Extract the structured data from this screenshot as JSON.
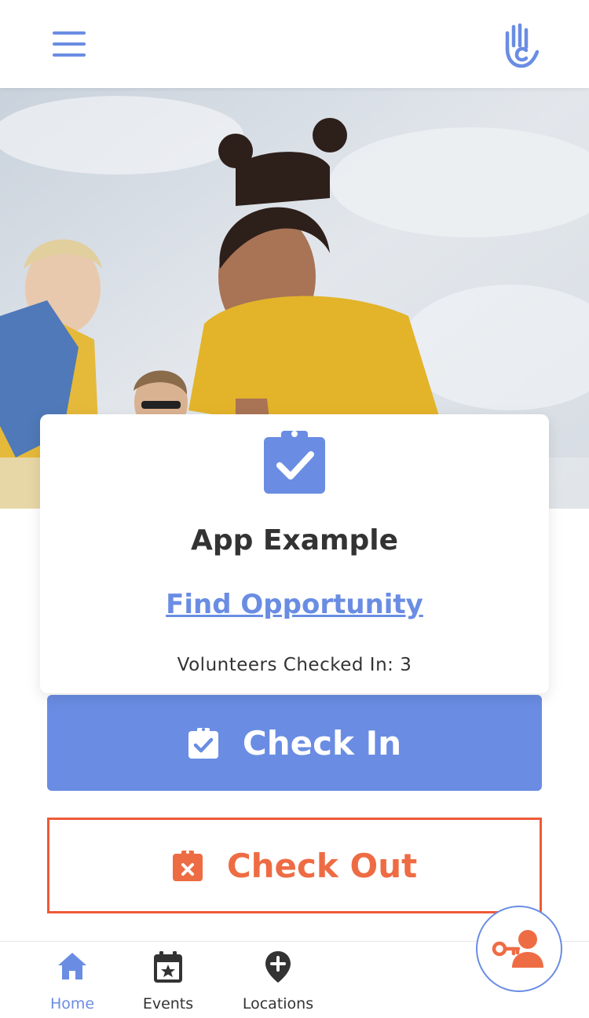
{
  "header": {
    "menu_icon": "hamburger-menu-icon",
    "logo_icon": "hand-logo-icon"
  },
  "hero": {
    "image": "children-volunteering-photo"
  },
  "card": {
    "icon": "clipboard-check-icon",
    "title": "App Example",
    "link": "Find Opportunity",
    "volunteers_checked_in": "Volunteers Checked In: 3"
  },
  "buttons": {
    "check_in": {
      "label": "Check In",
      "icon": "clipboard-check-icon"
    },
    "check_out": {
      "label": "Check Out",
      "icon": "clipboard-x-icon"
    }
  },
  "tabbar": {
    "items": [
      {
        "label": "Home",
        "icon": "home-icon",
        "active": true
      },
      {
        "label": "Events",
        "icon": "calendar-star-icon",
        "active": false
      },
      {
        "label": "Locations",
        "icon": "map-pin-plus-icon",
        "active": false
      }
    ]
  },
  "fab": {
    "icon": "key-user-icon"
  },
  "colors": {
    "primary": "#6a8de3",
    "accent": "#ee6c44",
    "text": "#333333"
  }
}
